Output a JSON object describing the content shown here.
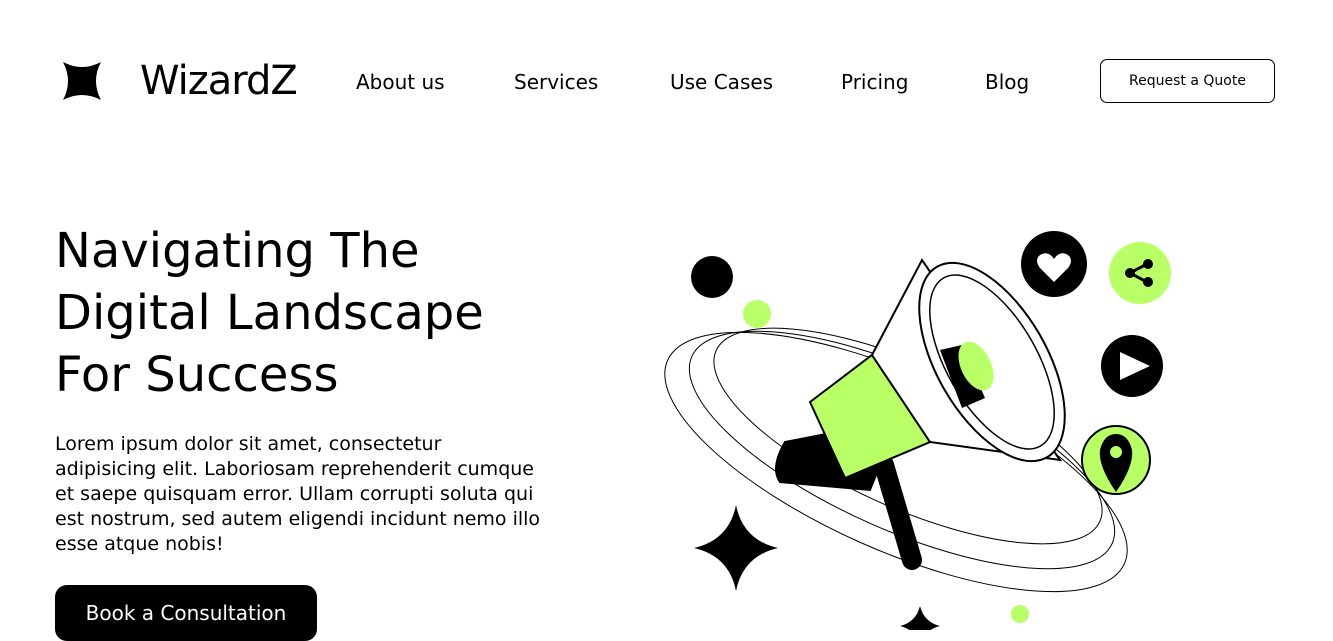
{
  "brand": {
    "name": "WizardZ",
    "logo_icon": "four-point-star-icon"
  },
  "nav": {
    "links": [
      "About us",
      "Services",
      "Use Cases",
      "Pricing",
      "Blog"
    ],
    "quote_button": "Request a Quote"
  },
  "hero": {
    "title_lines": [
      "Navigating The",
      "Digital Landscape",
      "For Success"
    ],
    "description": "Lorem ipsum dolor sit amet, consectetur adipisicing elit. Laboriosam reprehenderit cumque et saepe quisquam error. Ullam corrupti soluta qui est nostrum, sed autem eligendi incidunt nemo illo esse atque nobis!",
    "cta_button": "Book a Consultation"
  },
  "illustration": {
    "icons": [
      "megaphone-icon",
      "heart-icon",
      "share-icon",
      "play-icon",
      "location-pin-icon",
      "sparkle-star-icon"
    ]
  },
  "colors": {
    "accent": "#B9FF66",
    "dark": "#000000",
    "background": "#FFFFFF"
  }
}
